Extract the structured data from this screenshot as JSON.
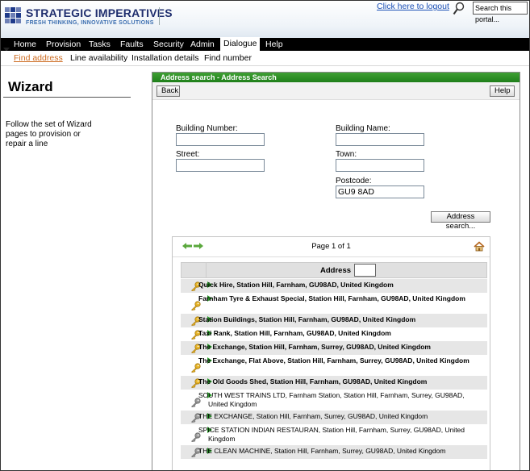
{
  "header": {
    "brand_title": "STRATEGIC IMPERATIVES",
    "brand_tagline": "FRESH THINKING, INNOVATIVE SOLUTIONS",
    "logout_link": "Click here to logout",
    "search_placeholder": "Search this portal...",
    "brand_color": "#1f2e6e"
  },
  "nav": {
    "items": [
      "Home",
      "Provision",
      "Tasks",
      "Faults",
      "Security",
      "Admin",
      "Dialogue",
      "Help"
    ],
    "active": "Dialogue"
  },
  "subnav": {
    "items": [
      "Find address",
      "Line availability",
      "Installation details",
      "Find number"
    ],
    "active": "Find address"
  },
  "sidebar": {
    "title": "Wizard",
    "description": "Follow the set of Wizard pages to provision or repair a line"
  },
  "panel": {
    "title": "Address search - Address Search",
    "back_button": "Back",
    "help_button": "Help",
    "accent_color": "#2e8f27",
    "form": {
      "building_number_label": "Building Number:",
      "building_number_value": "",
      "building_name_label": "Building Name:",
      "building_name_value": "",
      "street_label": "Street:",
      "street_value": "",
      "town_label": "Town:",
      "town_value": "",
      "postcode_label": "Postcode:",
      "postcode_value": "GU9 8AD",
      "search_button": "Address search..."
    },
    "results": {
      "page_label": "Page 1 of 1",
      "column_header": "Address",
      "filter_value": "",
      "rows": [
        {
          "text": "Quick Hire, Station Hill, Farnham, GU98AD, United Kingdom",
          "bold": true,
          "key": "gold"
        },
        {
          "text": "Farnham Tyre & Exhaust Special, Station Hill, Farnham, GU98AD, United Kingdom",
          "bold": true,
          "key": "gold"
        },
        {
          "text": "Station Buildings, Station Hill, Farnham, GU98AD, United Kingdom",
          "bold": true,
          "key": "gold"
        },
        {
          "text": "Taxi Rank, Station Hill, Farnham, GU98AD, United Kingdom",
          "bold": true,
          "key": "gold"
        },
        {
          "text": "The Exchange, Station Hill, Farnham, Surrey, GU98AD, United Kingdom",
          "bold": true,
          "key": "gold"
        },
        {
          "text": "The Exchange, Flat Above, Station Hill, Farnham, Surrey, GU98AD, United Kingdom",
          "bold": true,
          "key": "gold"
        },
        {
          "text": "The Old Goods Shed, Station Hill, Farnham, GU98AD, United Kingdom",
          "bold": true,
          "key": "gold"
        },
        {
          "text": "SOUTH WEST TRAINS LTD, Farnham Station, Station Hill, Farnham, Surrey, GU98AD, United Kingdom",
          "bold": false,
          "key": "grey"
        },
        {
          "text": "THE EXCHANGE, Station Hill, Farnham, Surrey, GU98AD, United Kingdom",
          "bold": false,
          "key": "grey"
        },
        {
          "text": "SPICE STATION INDIAN RESTAURAN, Station Hill, Farnham, Surrey, GU98AD, United Kingdom",
          "bold": false,
          "key": "grey"
        },
        {
          "text": "THE CLEAN MACHINE, Station Hill, Farnham, Surrey, GU98AD, United Kingdom",
          "bold": false,
          "key": "grey"
        }
      ]
    }
  }
}
